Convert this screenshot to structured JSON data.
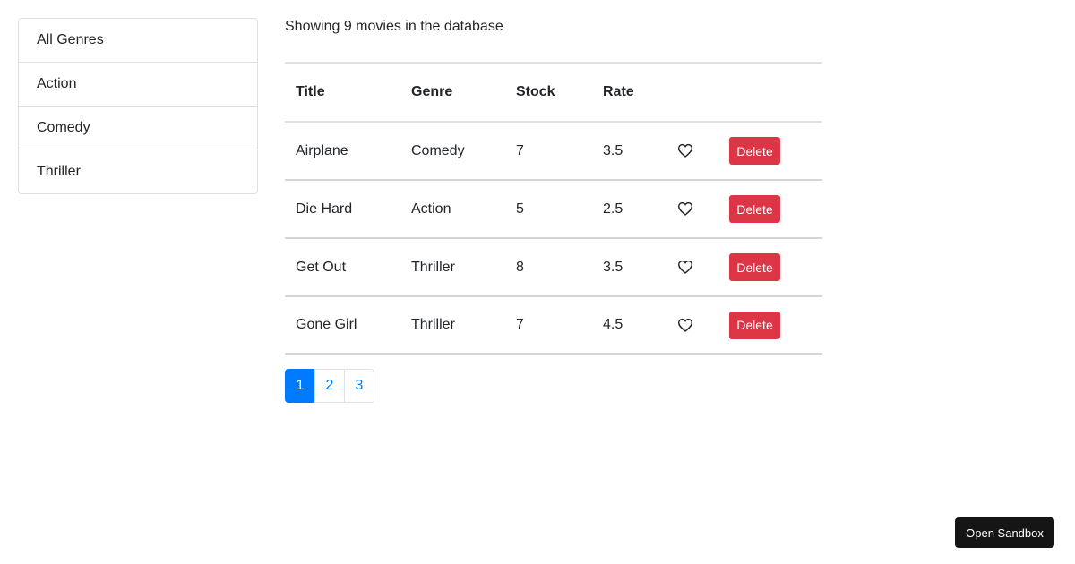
{
  "genres": {
    "items": [
      "All Genres",
      "Action",
      "Comedy",
      "Thriller"
    ]
  },
  "summary": {
    "text": "Showing 9 movies in the database"
  },
  "table": {
    "headers": [
      "Title",
      "Genre",
      "Stock",
      "Rate"
    ],
    "rows": [
      {
        "title": "Airplane",
        "genre": "Comedy",
        "stock": "7",
        "rate": "3.5",
        "delete_label": "Delete"
      },
      {
        "title": "Die Hard",
        "genre": "Action",
        "stock": "5",
        "rate": "2.5",
        "delete_label": "Delete"
      },
      {
        "title": "Get Out",
        "genre": "Thriller",
        "stock": "8",
        "rate": "3.5",
        "delete_label": "Delete"
      },
      {
        "title": "Gone Girl",
        "genre": "Thriller",
        "stock": "7",
        "rate": "4.5",
        "delete_label": "Delete"
      }
    ],
    "like_icon": "heart-outline-icon"
  },
  "pagination": {
    "pages": [
      "1",
      "2",
      "3"
    ],
    "active_page": "1"
  },
  "sandbox": {
    "label": "Open Sandbox"
  },
  "colors": {
    "primary": "#007bff",
    "danger": "#dc3545",
    "sandbox_bg": "#151515"
  }
}
